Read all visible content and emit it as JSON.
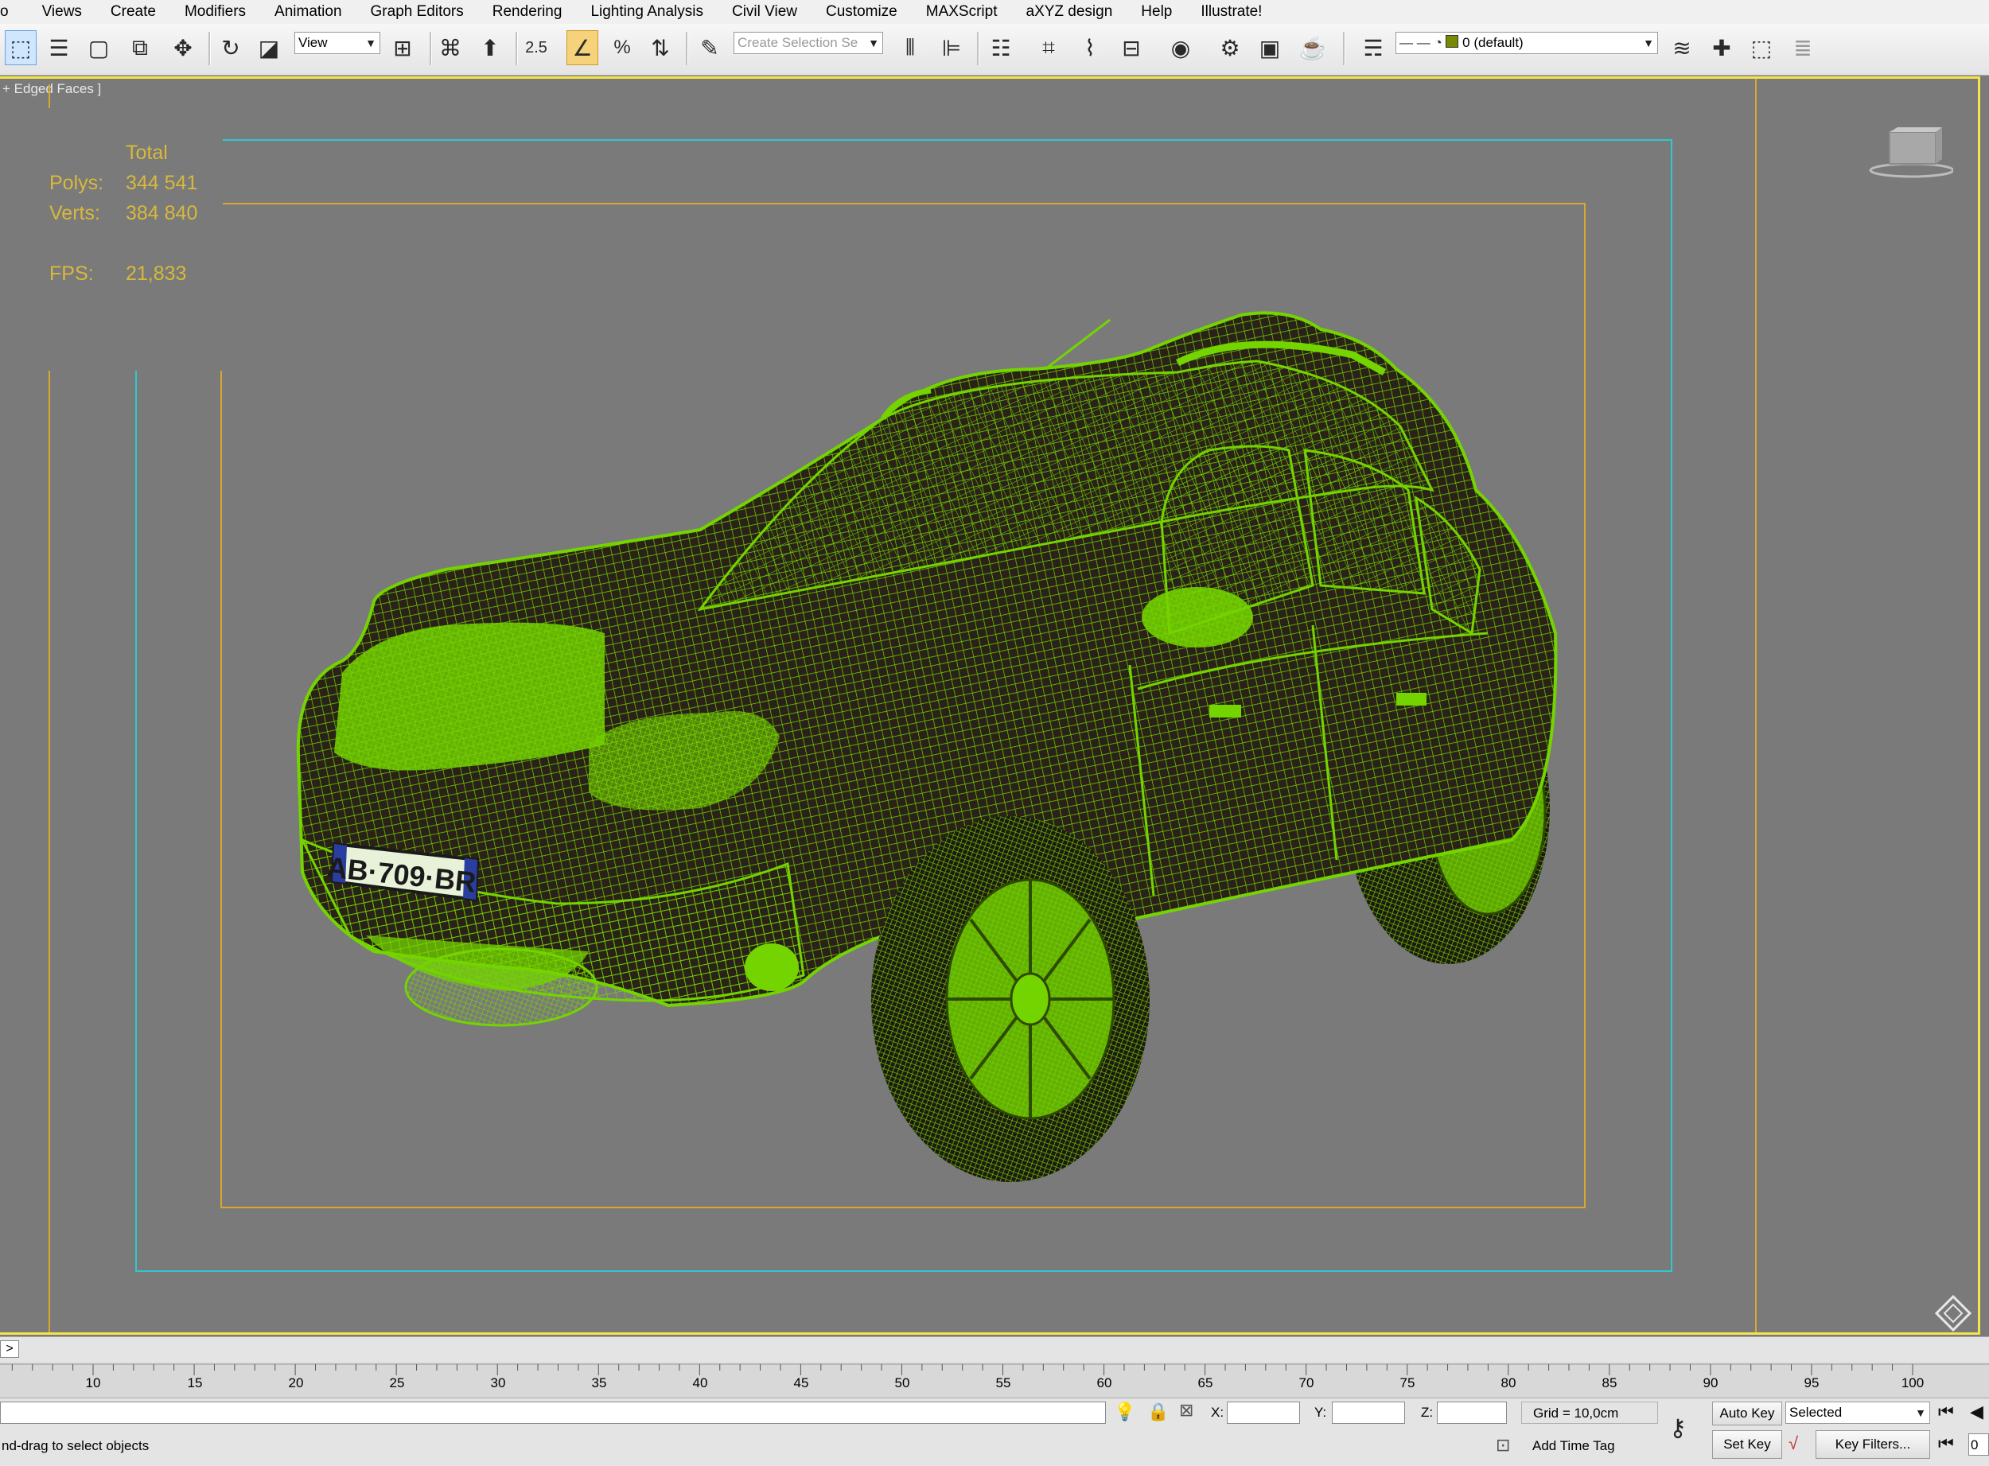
{
  "menu": {
    "items": [
      "o",
      "Views",
      "Create",
      "Modifiers",
      "Animation",
      "Graph Editors",
      "Rendering",
      "Lighting Analysis",
      "Civil View",
      "Customize",
      "MAXScript",
      "aXYZ design",
      "Help",
      "Illustrate!"
    ]
  },
  "toolbar": {
    "ref_coord": "View",
    "snap_label": "2.5",
    "selection_set_placeholder": "Create Selection Se",
    "layer": "0 (default)"
  },
  "viewport": {
    "label": "+ Edged Faces ]",
    "stats": {
      "total_label": "Total",
      "polys_label": "Polys:",
      "polys_value": "344 541",
      "verts_label": "Verts:",
      "verts_value": "384 840",
      "fps_label": "FPS:",
      "fps_value": "21,833"
    },
    "license_plate": "AB·709·BR"
  },
  "timeline": {
    "expand_label": ">",
    "ticks": [
      "10",
      "15",
      "20",
      "25",
      "30",
      "35",
      "40",
      "45",
      "50",
      "55",
      "60",
      "65",
      "70",
      "75",
      "80",
      "85",
      "90",
      "95",
      "100"
    ]
  },
  "status": {
    "prompt": "nd-drag to select objects",
    "x_label": "X:",
    "y_label": "Y:",
    "z_label": "Z:",
    "grid": "Grid = 10,0cm",
    "add_time_tag": "Add Time Tag",
    "auto_key": "Auto Key",
    "set_key": "Set Key",
    "selected": "Selected",
    "key_filters": "Key Filters...",
    "frame_value": "0"
  },
  "colors": {
    "wire": "#74d400",
    "stats": "#d8b93a",
    "viewport_border": "#f5e44a",
    "safe_frame_outer": "#2ec8d0",
    "safe_frame_inner": "#d9a62e"
  }
}
